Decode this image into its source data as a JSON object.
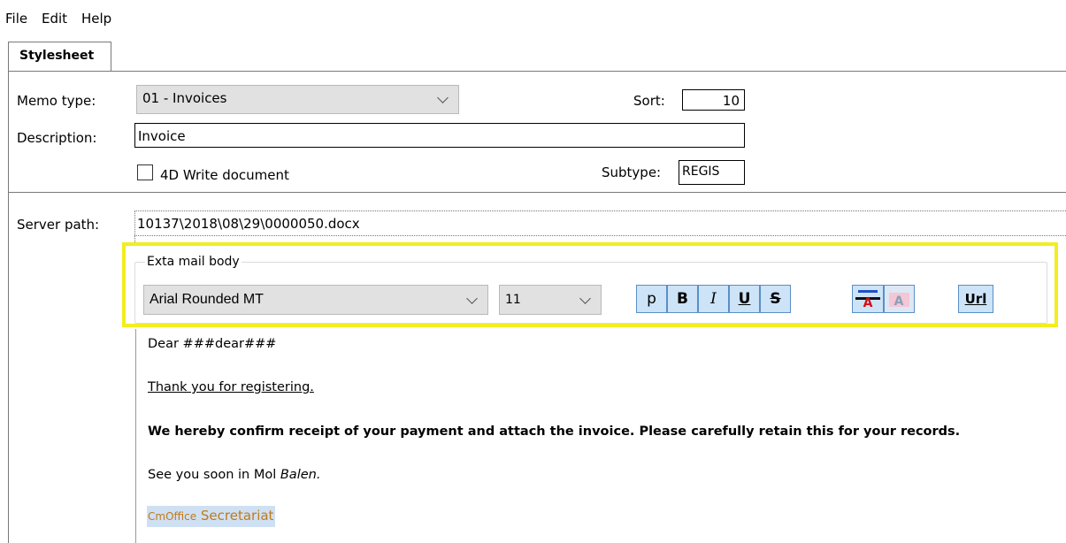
{
  "menu": {
    "file": "File",
    "edit": "Edit",
    "help": "Help"
  },
  "tab": {
    "label": "Stylesheet"
  },
  "form": {
    "memo_type_label": "Memo type:",
    "memo_type_value": "01 - Invoices",
    "sort_label": "Sort:",
    "sort_value": "10",
    "description_label": "Description:",
    "description_value": "Invoice",
    "write_doc_label": "4D Write document",
    "write_doc_checked": false,
    "subtype_label": "Subtype:",
    "subtype_value": "REGIS",
    "server_path_label": "Server path:",
    "server_path_value": "10137\\2018\\08\\29\\0000050.docx"
  },
  "mailbody": {
    "group_label": "Exta mail body",
    "font_value": "Arial Rounded MT",
    "size_value": "11",
    "buttons": {
      "plain": "p",
      "bold": "B",
      "italic": "I",
      "underline": "U",
      "strike": "S",
      "url": "Url"
    }
  },
  "document": {
    "line1": "Dear ###dear###",
    "line2": "Thank you for registering.",
    "line3": "We hereby confirm receipt of your payment and attach the invoice. Please carefully retain this for your records.",
    "line4_a": "See you soon in Mol ",
    "line4_b": "Balen.",
    "line5_a": "CmOffice",
    "line5_b": "Secretariat"
  },
  "colors": {
    "highlight": "#f2ee1f",
    "signature_text": "#c07a1a",
    "selection": "#cfe0f3"
  }
}
